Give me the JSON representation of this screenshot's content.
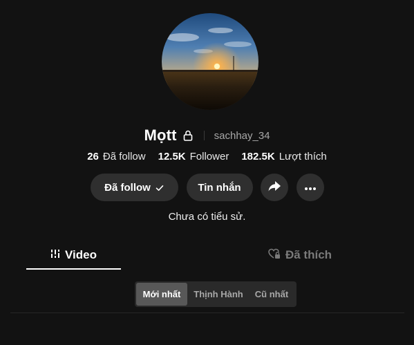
{
  "profile": {
    "display_name": "Mọtt",
    "username": "sachhay_34",
    "bio": "Chưa có tiểu sử."
  },
  "stats": [
    {
      "value": "26",
      "label": "Đã follow"
    },
    {
      "value": "12.5K",
      "label": "Follower"
    },
    {
      "value": "182.5K",
      "label": "Lượt thích"
    }
  ],
  "actions": {
    "follow_label": "Đã follow",
    "message_label": "Tin nhắn"
  },
  "tabs": [
    {
      "label": "Video",
      "active": true
    },
    {
      "label": "Đã thích",
      "active": false
    }
  ],
  "sort": {
    "options": [
      "Mới nhất",
      "Thịnh Hành",
      "Cũ nhất"
    ],
    "selected": "Mới nhất"
  },
  "icons": {
    "lock": "lock-icon",
    "check": "check-icon",
    "share": "share-icon",
    "more": "more-icon",
    "video_tab": "video-grid-icon",
    "liked_tab": "heart-lock-icon"
  },
  "colors": {
    "background": "#121212",
    "button_bg": "#2f2f2f",
    "muted_text": "#a8a8a8",
    "inactive_tab": "#7a7a7a"
  }
}
